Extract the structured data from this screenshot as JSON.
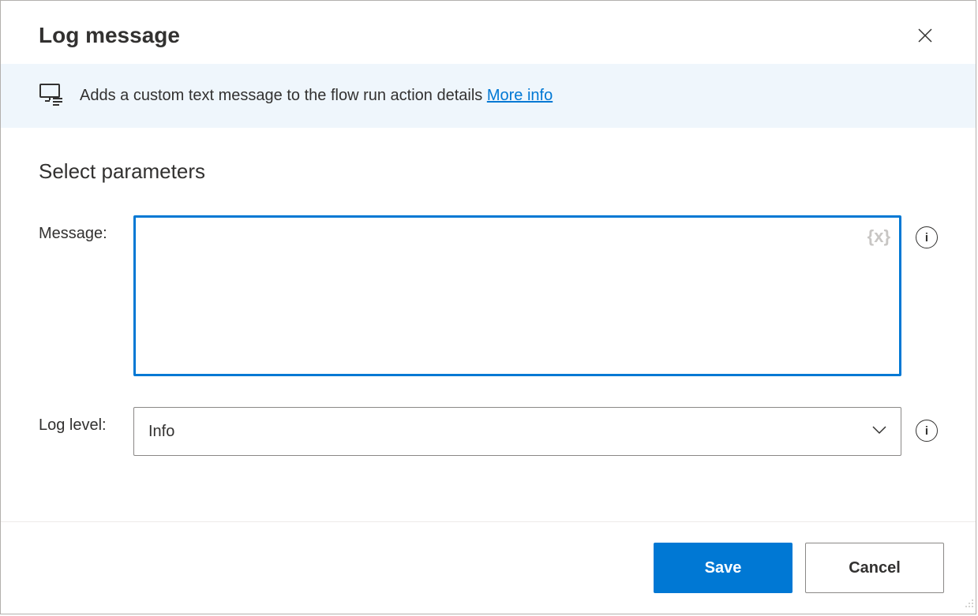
{
  "dialog": {
    "title": "Log message"
  },
  "banner": {
    "text": "Adds a custom text message to the flow run action details ",
    "link_label": "More info"
  },
  "section": {
    "heading": "Select parameters"
  },
  "params": {
    "message": {
      "label": "Message:",
      "value": ""
    },
    "log_level": {
      "label": "Log level:",
      "value": "Info"
    }
  },
  "footer": {
    "save_label": "Save",
    "cancel_label": "Cancel"
  }
}
